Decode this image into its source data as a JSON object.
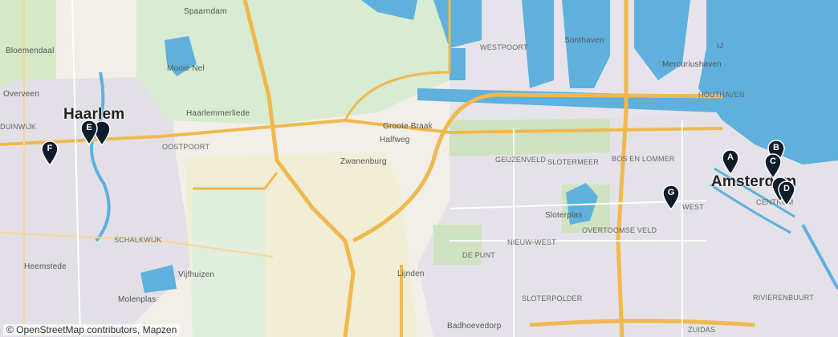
{
  "map": {
    "labels": {
      "spaarndam": "Spaarndam",
      "bloemendaal": "Bloemendaal",
      "mooie_nel": "Mooie Nel",
      "overveen": "Overveen",
      "haarlem": "Haarlem",
      "duinwijk": "DUINWIJK",
      "haarlemmerliede": "Haarlemmerliede",
      "oostpoort": "OOSTPOORT",
      "westpoort": "WESTPOORT",
      "sonthaven": "Sonthaven",
      "mercuriushaven": "Mercuriushaven",
      "houthaven": "HOUTHAVEN",
      "groote_braak": "Groote Braak",
      "halfweg": "Halfweg",
      "zwanenburg": "Zwanenburg",
      "geuzenveld": "GEUZENVELD",
      "slotermeer": "SLOTERMEER",
      "bos_en_lommer": "BOS EN LOMMER",
      "amsterdam": "Amsterdam",
      "centrum": "CENTRUM",
      "west": "WEST",
      "sloterplas": "Sloterplas",
      "nieuw_west": "NIEUW-WEST",
      "overtoomse_veld": "OVERTOOMSE VELD",
      "schalkwijk": "SCHALKWIJK",
      "de_punt": "DE PUNT",
      "lijnden": "Lijnden",
      "heemstede": "Heemstede",
      "vijfhuizen": "Vijfhuizen",
      "molenplas": "Molenplas",
      "slotervaart": "SLOTERPOLDER",
      "rivierenbuurt": "RIVIERENBUURT",
      "badhoevedorp": "Badhoevedorp",
      "zuidas": "ZUIDAS",
      "ij": "IJ"
    },
    "markers": [
      {
        "letter": "A"
      },
      {
        "letter": "B"
      },
      {
        "letter": "C"
      },
      {
        "letter": "D"
      },
      {
        "letter": "E"
      },
      {
        "letter": "F"
      },
      {
        "letter": "G"
      }
    ],
    "attribution": "© OpenStreetMap contributors, Mapzen",
    "colors": {
      "land": "#f2efe9",
      "water": "#5fb0dd",
      "urban": "#e3e1e6",
      "green": "#cfe8c2",
      "farmland": "#f1eed5",
      "motorway": "#f0b84e",
      "road": "#ffffff",
      "marker": "#0f1c2b"
    }
  }
}
